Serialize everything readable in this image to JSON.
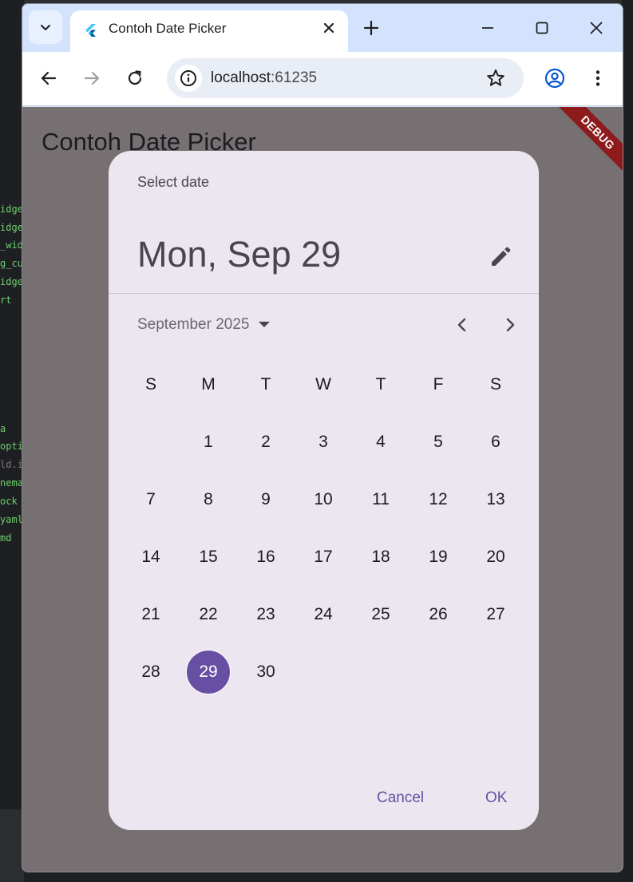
{
  "ide": {
    "lines": [
      "idget",
      "idget",
      "_widg",
      "g_cu",
      "idget",
      "rt",
      "",
      "a",
      "optio",
      "ld.im",
      "nema",
      "ock",
      "yaml",
      "md"
    ]
  },
  "browser": {
    "tab_title": "Contoh Date Picker",
    "url_host": "localhost",
    "url_port": ":61235"
  },
  "app": {
    "title": "Contoh Date Picker",
    "debug_banner": "DEBUG"
  },
  "dialog": {
    "header_label": "Select date",
    "selected_date_text": "Mon, Sep 29",
    "month_label": "September 2025",
    "weekdays": [
      "S",
      "M",
      "T",
      "W",
      "T",
      "F",
      "S"
    ],
    "first_weekday_offset": 1,
    "days_in_month": 30,
    "selected_day": 29,
    "cancel_label": "Cancel",
    "ok_label": "OK"
  },
  "colors": {
    "accent": "#6750a4",
    "dialog_bg": "#ece6f0",
    "scrim": "#767073",
    "chrome_tabstrip": "#d3e3fd",
    "debug_banner": "#8e1b1b"
  }
}
